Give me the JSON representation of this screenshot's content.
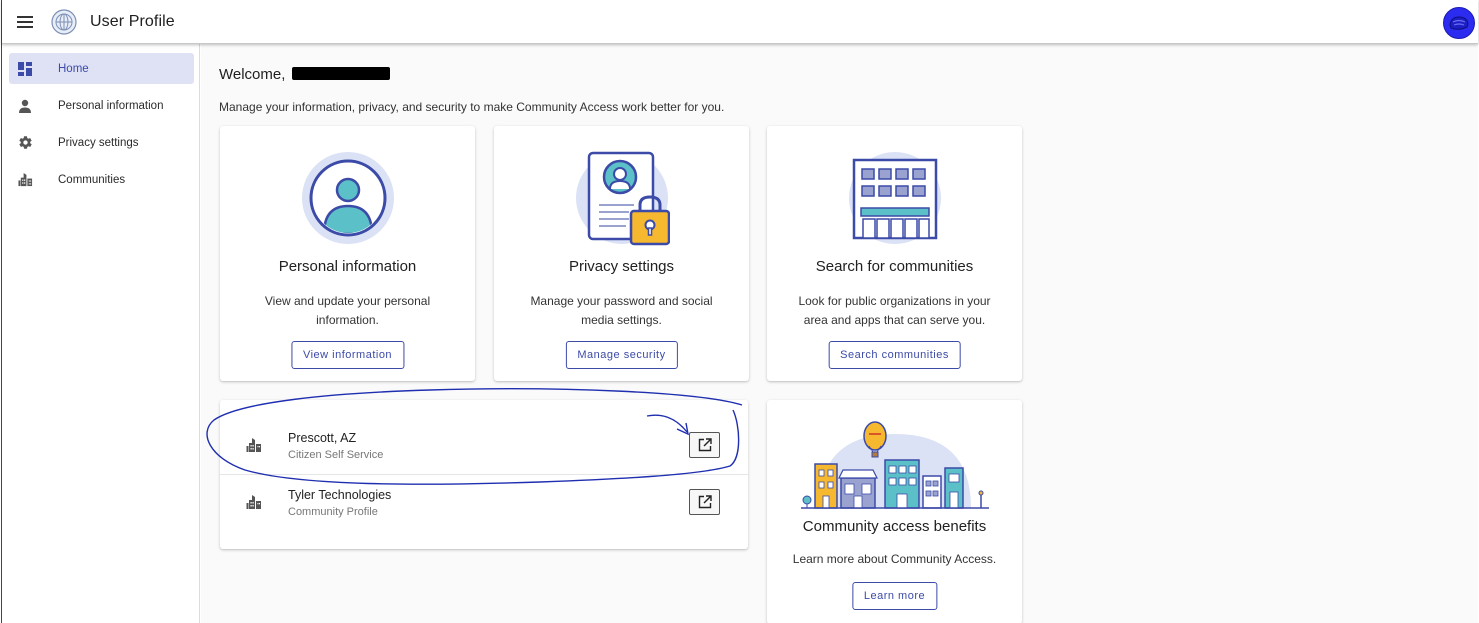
{
  "topbar": {
    "title": "User Profile",
    "menu_icon": "hamburger-menu-icon",
    "logo_icon": "globe-logo-icon",
    "avatar_icon": "user-avatar-icon"
  },
  "sidebar": {
    "items": [
      {
        "label": "Home",
        "icon": "dashboard-icon",
        "active": true
      },
      {
        "label": "Personal information",
        "icon": "person-icon",
        "active": false
      },
      {
        "label": "Privacy settings",
        "icon": "gear-icon",
        "active": false
      },
      {
        "label": "Communities",
        "icon": "city-buildings-icon",
        "active": false
      }
    ]
  },
  "main": {
    "welcome": "Welcome,",
    "subtitle": "Manage your information, privacy, and security to make Community Access work better for you.",
    "cards": [
      {
        "title": "Personal information",
        "description": "View and update your personal information.",
        "button": "View information"
      },
      {
        "title": "Privacy settings",
        "description": "Manage your password and social media settings.",
        "button": "Manage security"
      },
      {
        "title": "Search for communities",
        "description": "Look for public organizations in your area and apps that can serve you.",
        "button": "Search communities"
      }
    ],
    "communities": [
      {
        "name": "Prescott, AZ",
        "subtitle": "Citizen Self Service"
      },
      {
        "name": "Tyler Technologies",
        "subtitle": "Community Profile"
      }
    ],
    "benefits": {
      "title": "Community access benefits",
      "description": "Learn more about Community Access.",
      "button": "Learn more"
    }
  },
  "colors": {
    "accent": "#3c4aa8",
    "active_nav_bg": "#dfe2f5",
    "annotation_ink": "#1f2fb0",
    "avatar": "#2b2cf0"
  }
}
